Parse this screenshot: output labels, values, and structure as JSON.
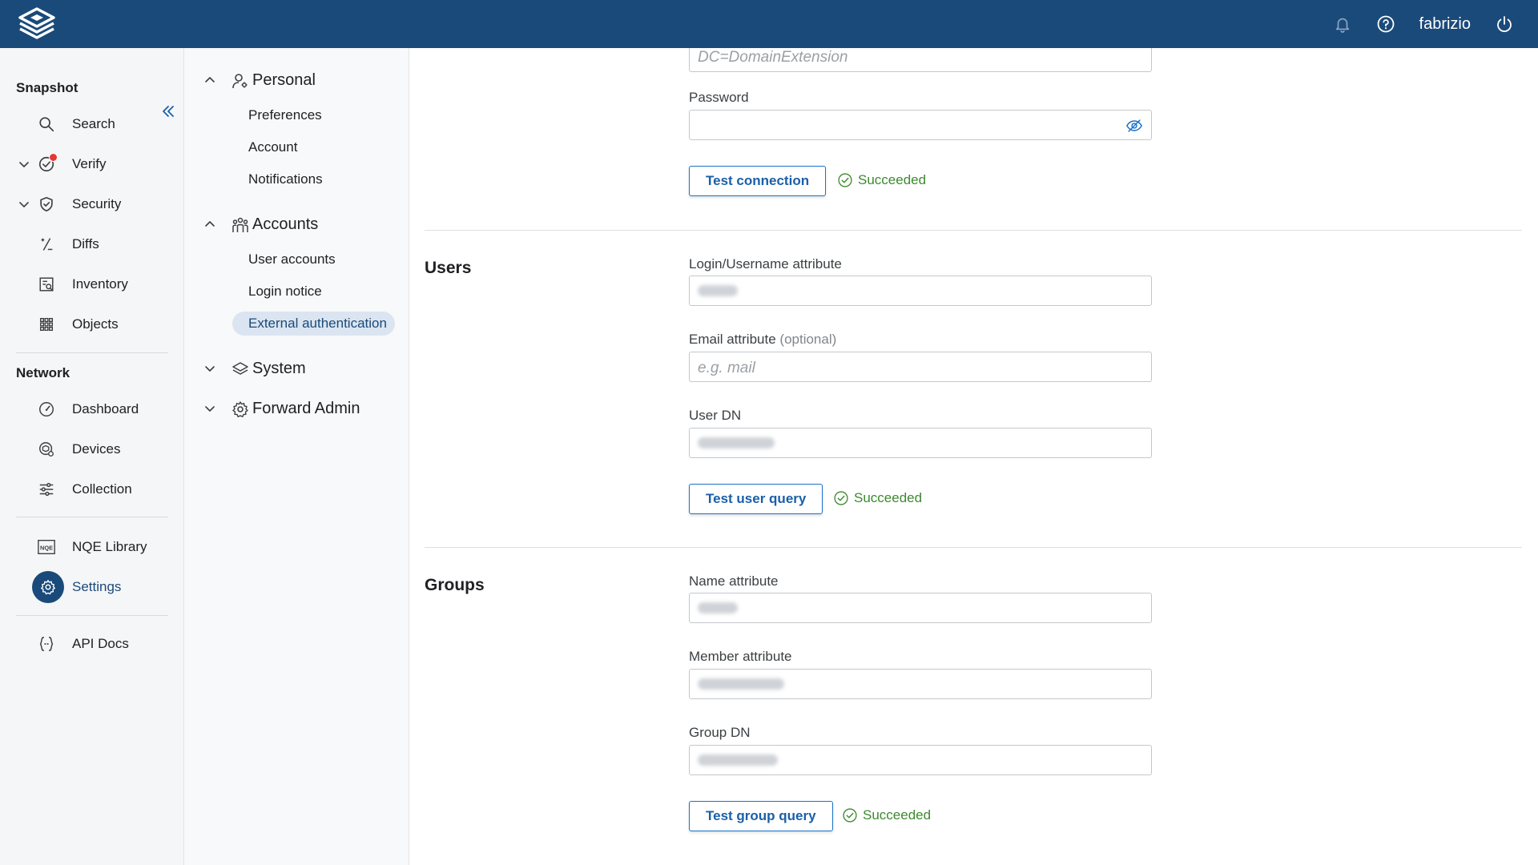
{
  "topbar": {
    "user": "fabrizio",
    "icons": [
      "bell-icon",
      "help-icon",
      "power-icon"
    ]
  },
  "nav": {
    "snapshot_section": "Snapshot",
    "network_section": "Network",
    "items": {
      "search": "Search",
      "verify": "Verify",
      "security": "Security",
      "diffs": "Diffs",
      "inventory": "Inventory",
      "objects": "Objects",
      "dashboard": "Dashboard",
      "devices": "Devices",
      "collection": "Collection",
      "nqe_library": "NQE Library",
      "settings": "Settings",
      "api_docs": "API Docs"
    }
  },
  "settings_nav": {
    "personal": {
      "label": "Personal",
      "items": [
        "Preferences",
        "Account",
        "Notifications"
      ]
    },
    "accounts": {
      "label": "Accounts",
      "items": [
        "User accounts",
        "Login notice",
        "External authentication"
      ]
    },
    "system": "System",
    "forward_admin": "Forward Admin",
    "active_item": "External authentication"
  },
  "connection": {
    "base_dn_placeholder": "DC=DomainExtension",
    "password_label": "Password",
    "password_value": "",
    "test_button": "Test connection",
    "status": "Succeeded"
  },
  "users": {
    "title": "Users",
    "login_label": "Login/Username attribute",
    "email_label": "Email attribute",
    "email_optional": "(optional)",
    "email_placeholder": "e.g. mail",
    "user_dn_label": "User DN",
    "test_button": "Test user query",
    "status": "Succeeded"
  },
  "groups": {
    "title": "Groups",
    "name_label": "Name attribute",
    "member_label": "Member attribute",
    "group_dn_label": "Group DN",
    "test_button": "Test group query",
    "status": "Succeeded"
  },
  "colors": {
    "topbar": "#1a4a7a",
    "accent": "#1a73c8",
    "success": "#3c8a2e",
    "badge": "#e53935"
  }
}
